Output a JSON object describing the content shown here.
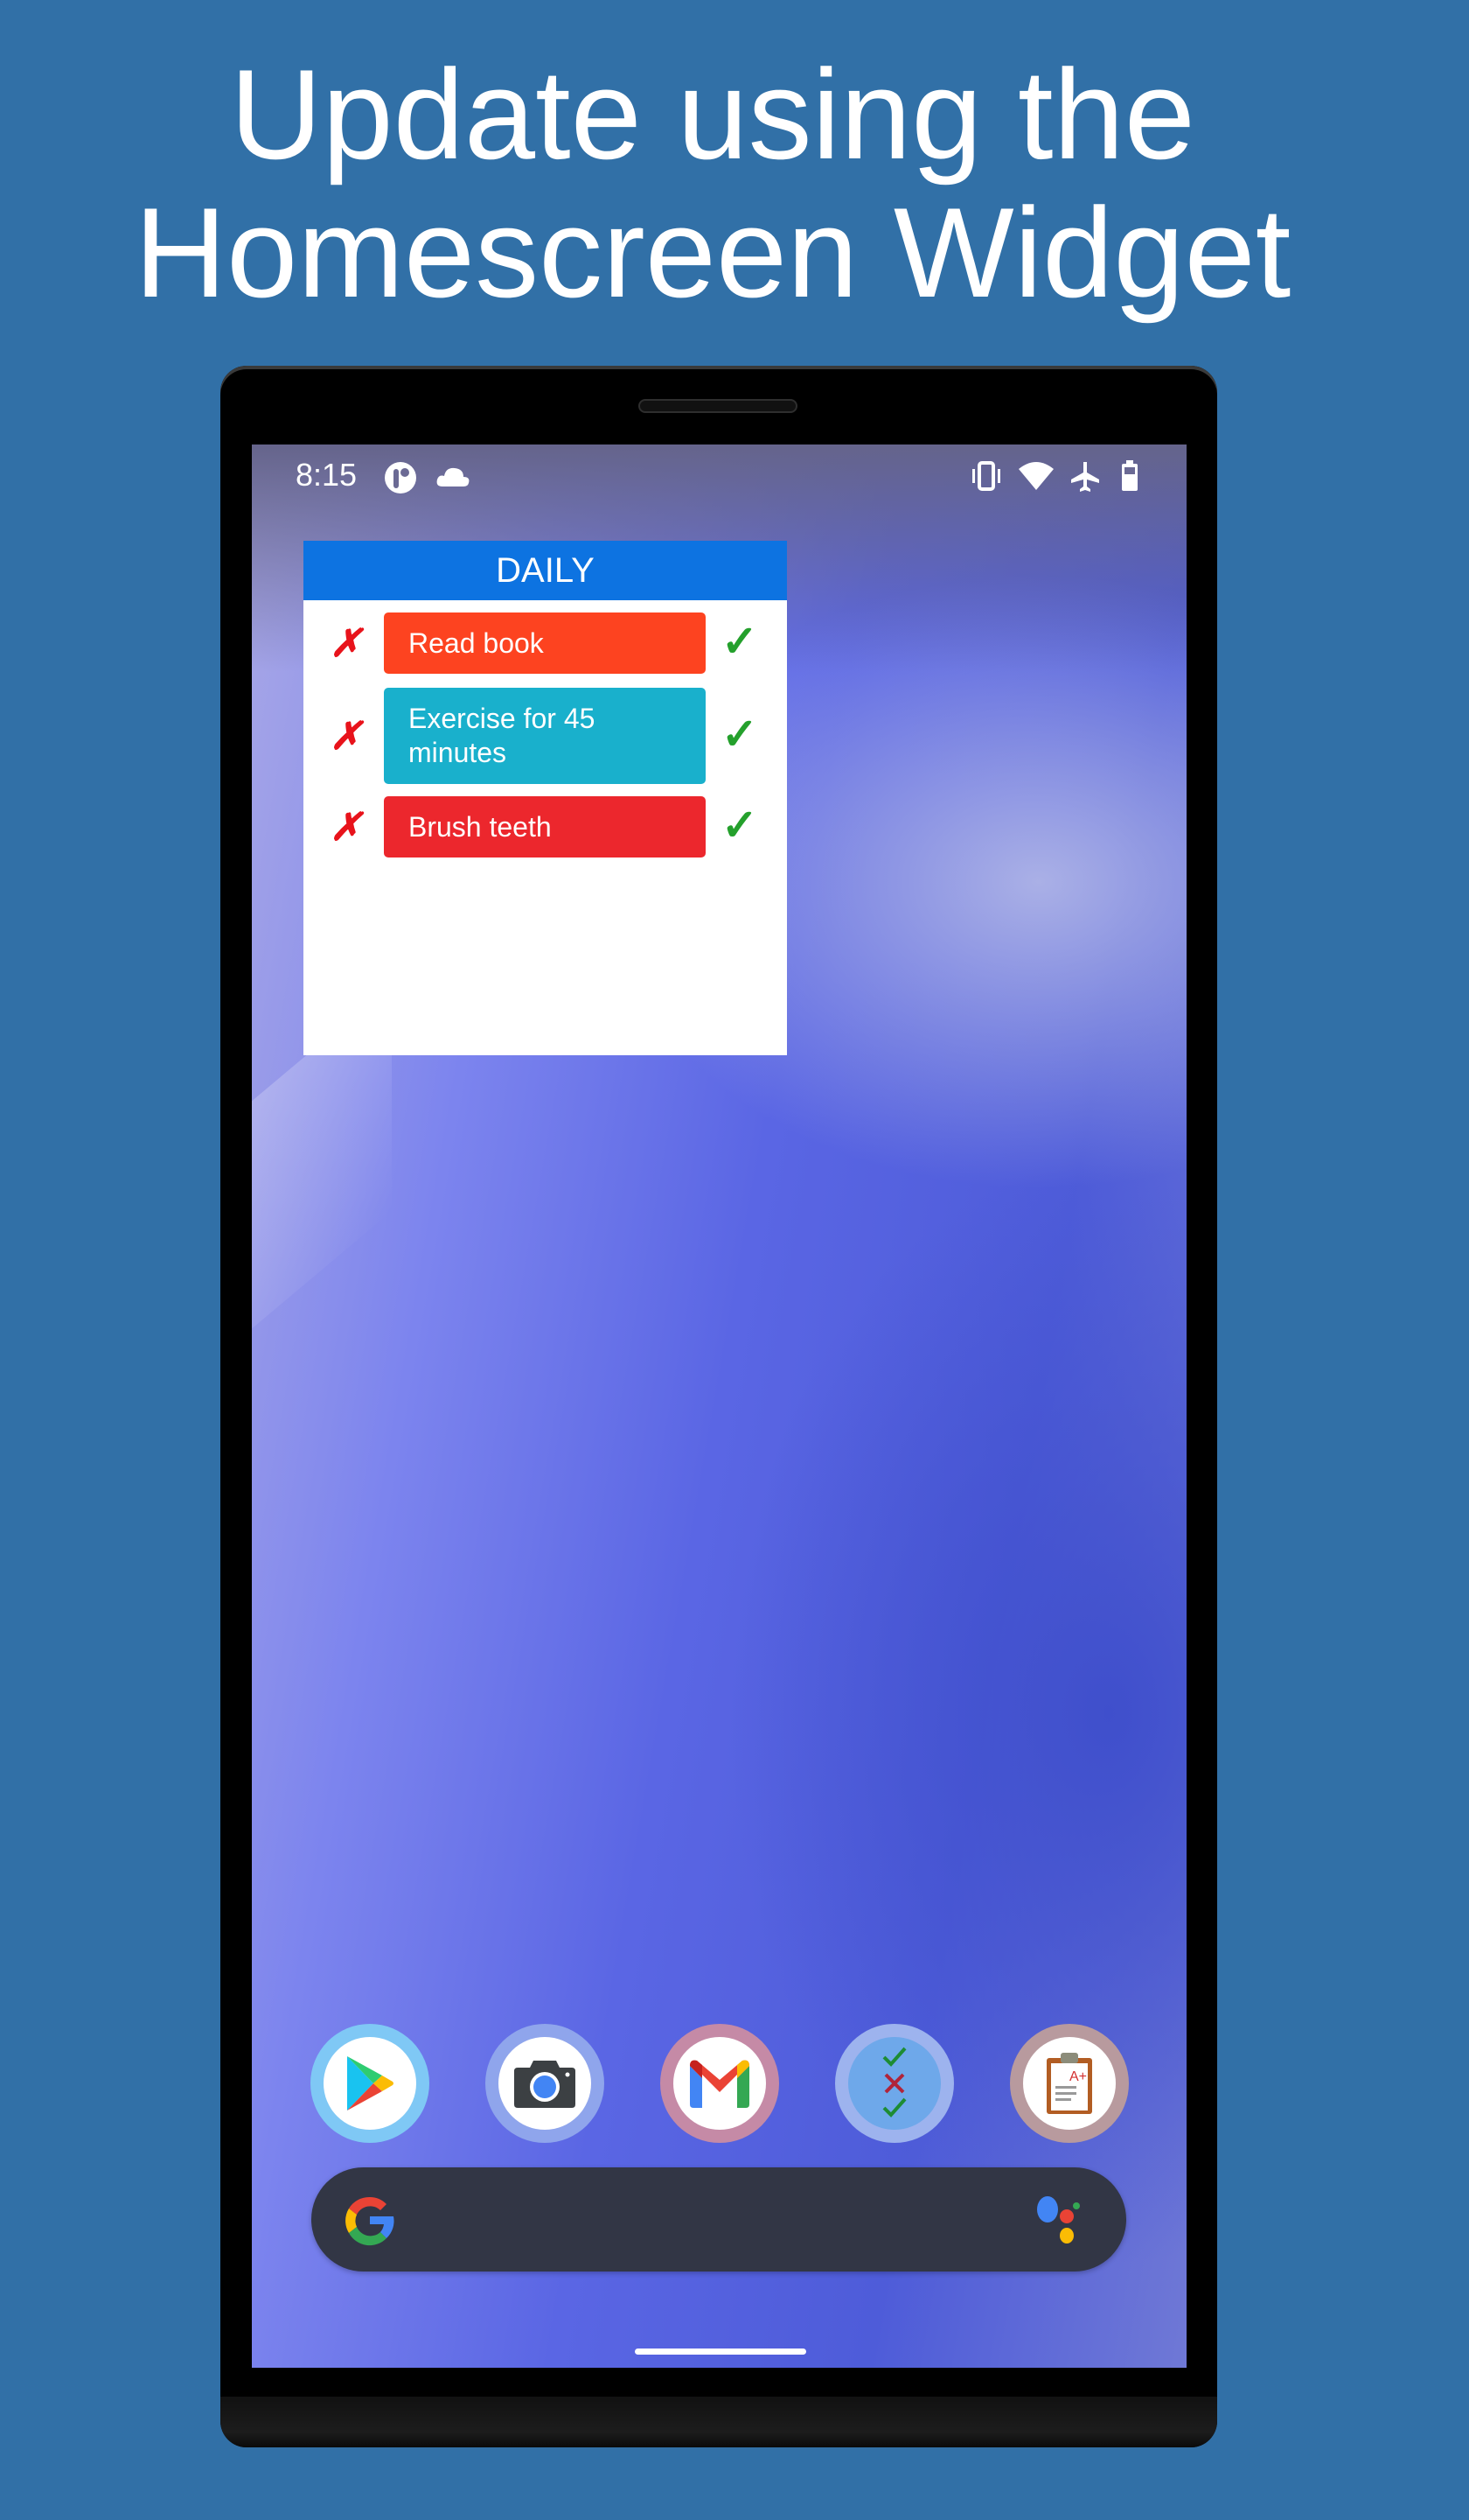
{
  "headline": {
    "line1": "Update using the",
    "line2": "Homescreen Widget"
  },
  "status_bar": {
    "time": "8:15",
    "left_icons": [
      "app-notification-icon",
      "cloud-icon"
    ],
    "right_icons": [
      "vibrate-icon",
      "wifi-icon",
      "airplane-mode-icon",
      "battery-icon"
    ]
  },
  "widget": {
    "title": "DAILY",
    "tasks": [
      {
        "label": "Read book",
        "color": "#fd4320",
        "fail_icon": "✗",
        "done_icon": "✓"
      },
      {
        "label": "Exercise for 45 minutes",
        "color": "#19b0cc",
        "fail_icon": "✗",
        "done_icon": "✓"
      },
      {
        "label": "Brush teeth",
        "color": "#ec272d",
        "fail_icon": "✗",
        "done_icon": "✓"
      }
    ]
  },
  "dock": {
    "apps": [
      {
        "name": "Play Store",
        "icon": "play-store-icon"
      },
      {
        "name": "Camera",
        "icon": "camera-icon"
      },
      {
        "name": "Gmail",
        "icon": "gmail-icon"
      },
      {
        "name": "Habit Tracker",
        "icon": "checklist-icon"
      },
      {
        "name": "Clipboard Grades",
        "icon": "clipboard-icon"
      }
    ]
  },
  "search": {
    "icon_left": "google-g-icon",
    "icon_right": "google-assistant-icon"
  },
  "colors": {
    "background": "#3170a7",
    "widget_header": "#0d73e1",
    "fail": "#e8131b",
    "done": "#24a02c"
  }
}
